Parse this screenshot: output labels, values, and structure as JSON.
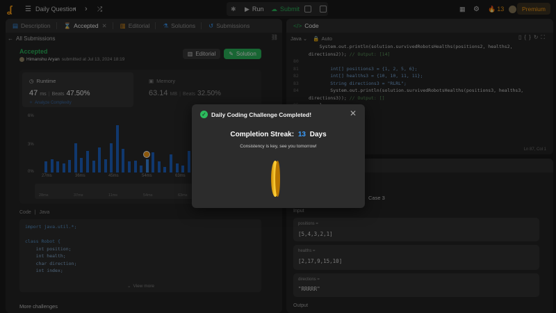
{
  "topbar": {
    "problem_list_label": "Daily Question",
    "run_label": "Run",
    "submit_label": "Submit",
    "streak_count": "13",
    "premium_label": "Premium"
  },
  "left_panel": {
    "tabs": [
      "Description",
      "Accepted",
      "Editorial",
      "Solutions",
      "Submissions"
    ],
    "back_label": "All Submissions",
    "status": "Accepted",
    "author": "Himanshu Aryan",
    "submitted_text": "submitted at Jul 13, 2024 18:19",
    "editorial_btn": "Editorial",
    "solution_btn": "Solution",
    "runtime_label": "Runtime",
    "runtime_value": "47",
    "runtime_unit": "ms",
    "beats_label": "Beats",
    "runtime_beats": "47.50%",
    "analyze_label": "Analyze Complexity",
    "memory_label": "Memory",
    "memory_value": "63.14",
    "memory_unit": "MB",
    "memory_beats": "32.50%",
    "chart_y_labels": [
      "6%",
      "3%",
      "0%"
    ],
    "chart_x_labels": [
      "27ms",
      "36ms",
      "45ms",
      "54ms",
      "63ms",
      "69ms"
    ],
    "mini_x_labels": [
      "28ms",
      "37ms",
      "11ms",
      "54ms",
      "63ms",
      "67ms"
    ],
    "code_header": "Code",
    "code_lang": "Java",
    "code_lines": [
      "import java.util.*;",
      "",
      "class Robot {",
      "    int position;",
      "    int health;",
      "    char direction;",
      "    int index;"
    ],
    "view_more": "View more",
    "more_challenges": "More challenges"
  },
  "chart_data": {
    "type": "bar",
    "x": [
      "27ms",
      "36ms",
      "45ms",
      "54ms",
      "63ms",
      "69ms"
    ],
    "values": [
      1.2,
      1.5,
      1.2,
      1.0,
      1.4,
      3.2,
      1.6,
      2.4,
      1.3,
      2.8,
      1.5,
      3.2,
      5.2,
      2.6,
      1.2,
      1.3,
      0.8,
      1.5,
      2.2,
      1.2,
      0.6,
      2.0,
      1.0,
      0.8,
      2.4,
      1.2,
      0.9,
      2.1,
      1.4,
      0.6,
      1.2,
      0.7,
      2.2,
      1.2,
      0.9
    ],
    "highlight_index": 17,
    "ylim": [
      0,
      6
    ]
  },
  "right_panel": {
    "code_tab": "Code",
    "lang": "Java",
    "auto": "Auto",
    "line_numbers": [
      "80",
      "81",
      "82",
      "83",
      "84",
      "85",
      "86"
    ],
    "code_lines": [
      "    System.out.println(solution.survivedRobotsHealths(positions2, healths2,",
      "directions2)); // Output: [14]",
      "",
      "        int[] positions3 = {1, 2, 5, 6};",
      "        int[] healths3 = {10, 10, 11, 11};",
      "        String directions3 = \"RLRL\";",
      "        System.out.println(solution.survivedRobotsHealths(positions3, healths3,",
      "directions3)); // Output: []",
      "    }",
      "}"
    ],
    "cursor_pos": "Ln 87, Col 1",
    "case_label": "Case 3",
    "input_label": "Input",
    "fields": [
      {
        "name": "positions =",
        "value": "[5,4,3,2,1]"
      },
      {
        "name": "healths =",
        "value": "[2,17,9,15,10]"
      },
      {
        "name": "directions =",
        "value": "\"RRRRR\""
      }
    ],
    "output_label": "Output"
  },
  "modal": {
    "title": "Daily Coding Challenge Completed!",
    "streak_label": "Completion Streak:",
    "streak_value": "13",
    "streak_unit": "Days",
    "message": "Consistency is key, see you tomorrow!"
  },
  "colors": {
    "accent": "#ffa116",
    "accepted": "#2cbb5d",
    "bar": "#1e66c8",
    "streak_blue": "#3b9eff"
  }
}
